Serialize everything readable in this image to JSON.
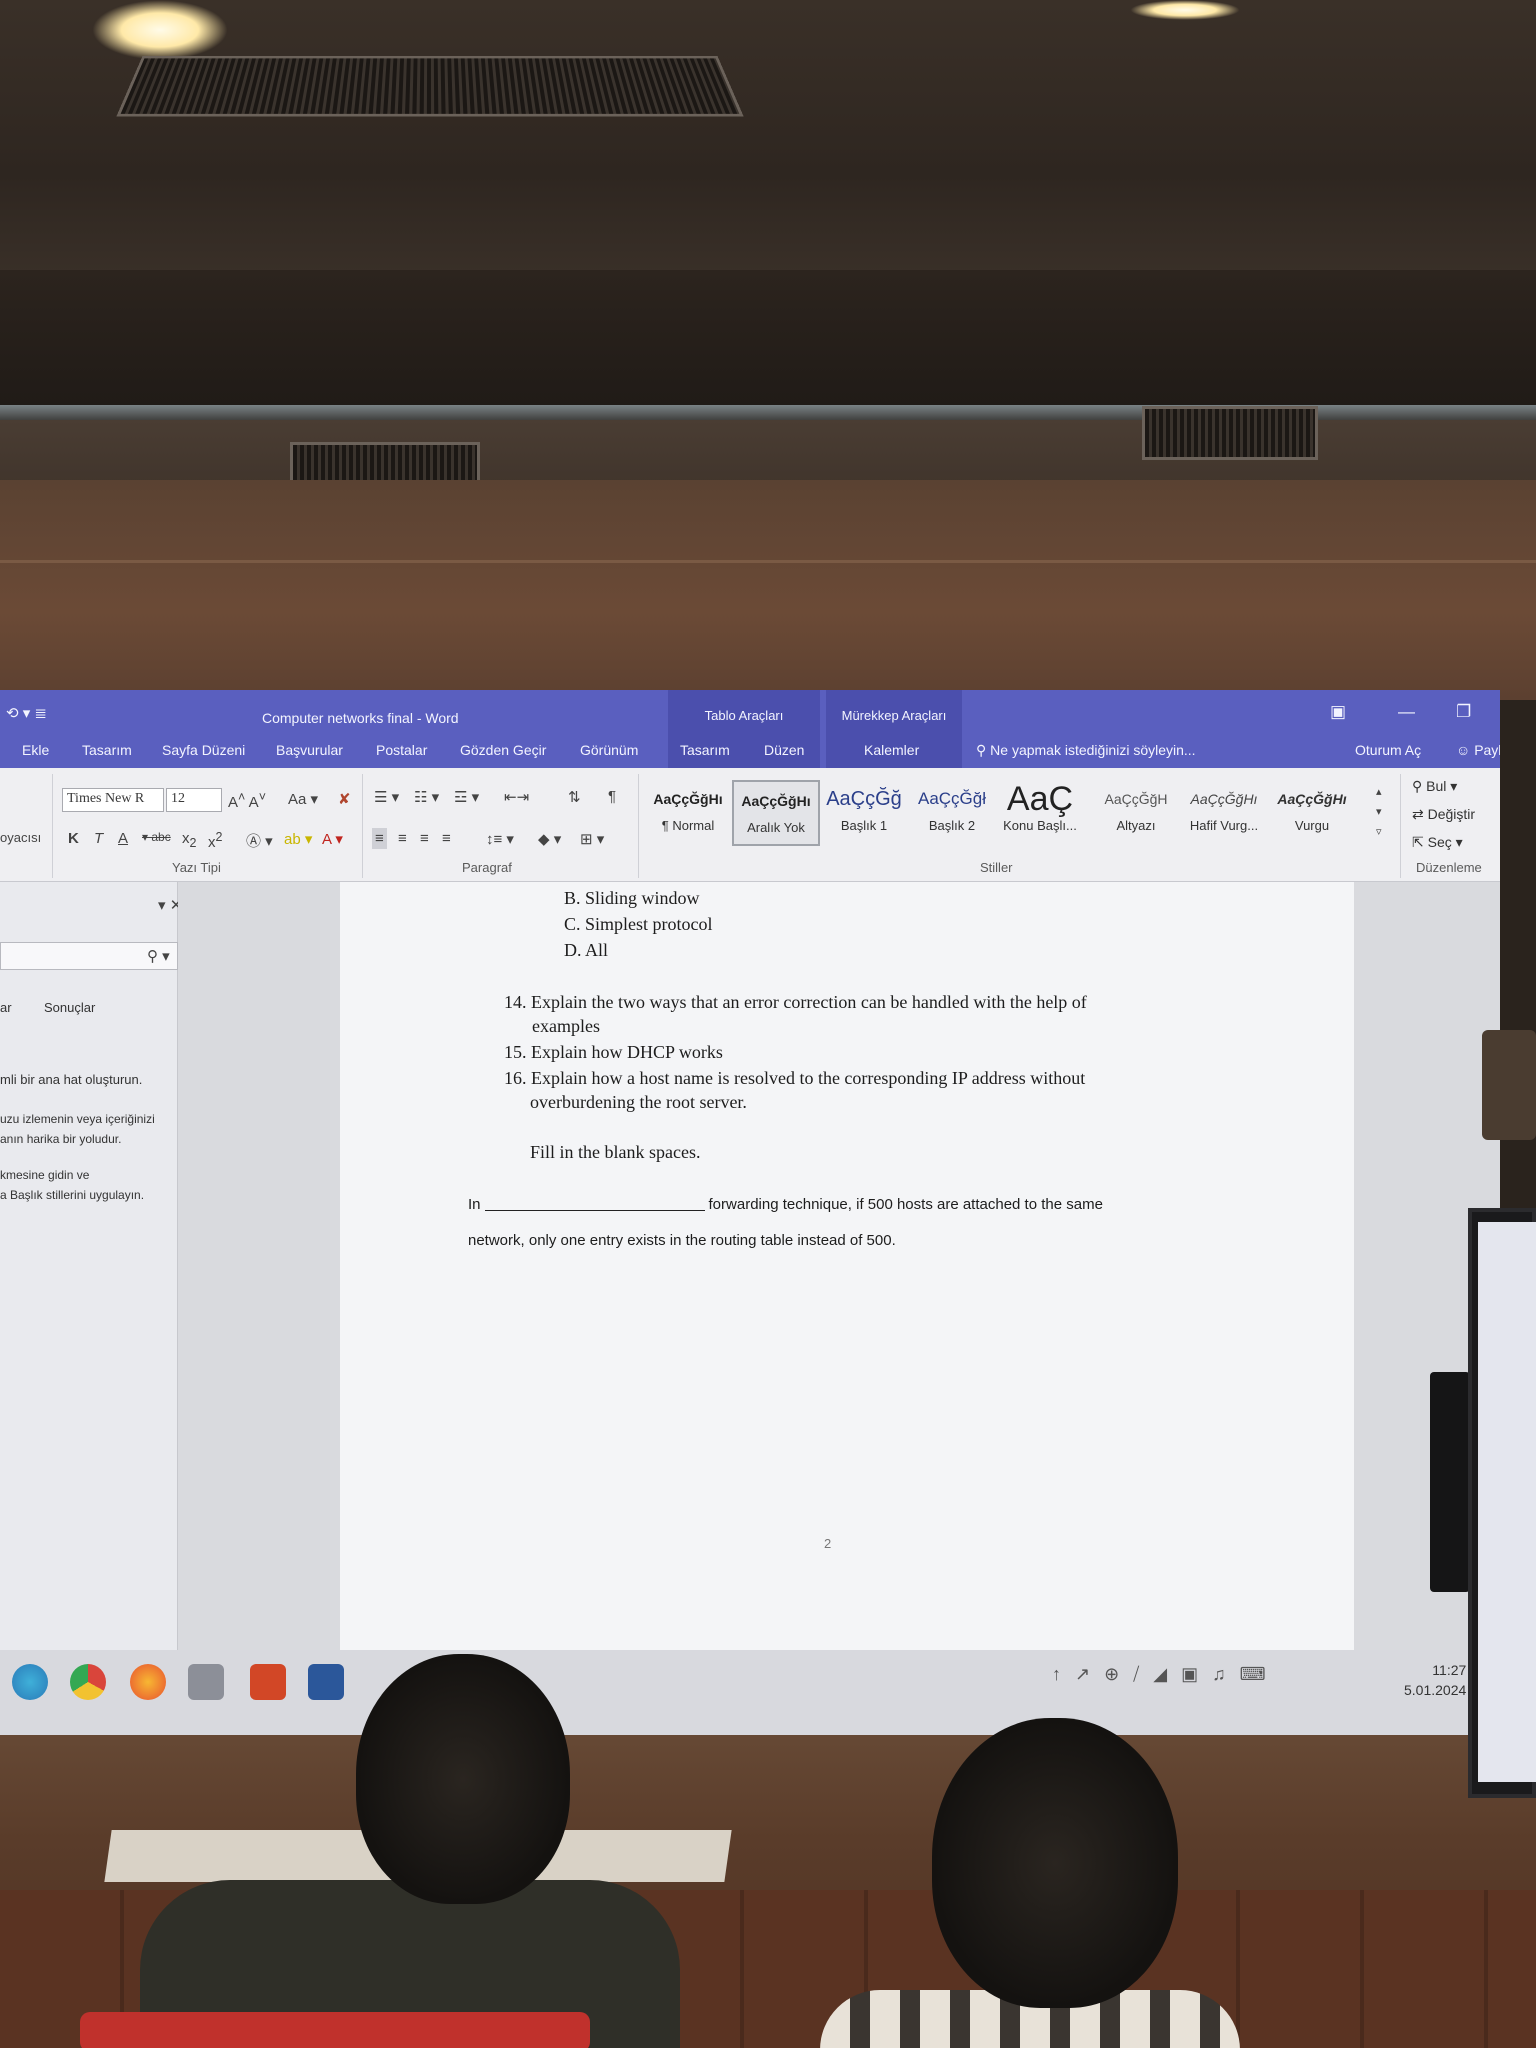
{
  "window": {
    "title": "Computer networks final - Word",
    "context_groups": [
      "Tablo Araçları",
      "Mürekkep Araçları"
    ],
    "tell_me": "Ne yapmak istediğinizi söyleyin...",
    "sign_in": "Oturum Aç",
    "share": "Paylaş"
  },
  "tabs": [
    "Ekle",
    "Tasarım",
    "Sayfa Düzeni",
    "Başvurular",
    "Postalar",
    "Gözden Geçir",
    "Görünüm",
    "Tasarım",
    "Düzen",
    "Kalemler"
  ],
  "ribbon": {
    "clipboard_label": "oyacısı",
    "font_name": "Times New R",
    "font_size": "12",
    "font_group_label": "Yazı Tipi",
    "paragraph_group_label": "Paragraf",
    "styles_group_label": "Stiller",
    "editing_group_label": "Düzenleme",
    "styles": [
      {
        "sample": "AaÇçĞğHı",
        "name": "¶ Normal"
      },
      {
        "sample": "AaÇçĞğHı",
        "name": "Aralık Yok"
      },
      {
        "sample": "AaÇçĞğ",
        "name": "Başlık 1"
      },
      {
        "sample": "AaÇçĞğł",
        "name": "Başlık 2"
      },
      {
        "sample": "AaÇ",
        "name": "Konu Başlı..."
      },
      {
        "sample": "AaÇçĞğH",
        "name": "Altyazı"
      },
      {
        "sample": "AaÇçĞğHı",
        "name": "Hafif Vurg..."
      },
      {
        "sample": "AaÇçĞğHı",
        "name": "Vurgu"
      }
    ],
    "editing": [
      "Bul",
      "Değiştir",
      "Seç"
    ]
  },
  "nav_pane": {
    "tabs": [
      "ar",
      "Sonuçlar"
    ],
    "lines": [
      "mli bir ana hat oluşturun.",
      "uzu izlemenin veya içeriğinizi",
      "anın harika bir yoludur.",
      "kmesine gidin ve",
      "a Başlık stillerini uygulayın."
    ]
  },
  "document": {
    "options": [
      "B.  Sliding window",
      "C.  Simplest protocol",
      "D.  All"
    ],
    "q14_a": "14. Explain the two ways that an error correction can be handled with the help of",
    "q14_b": "examples",
    "q15": "15. Explain how DHCP works",
    "q16_a": "16. Explain how a host name is resolved to the corresponding IP address without",
    "q16_b": "overburdening the root server.",
    "fill_heading": "Fill in the blank spaces.",
    "fill_prefix": "In",
    "fill_suffix": "forwarding technique, if 500 hosts are attached to the same",
    "fill_line2": "network, only one entry exists in the routing table instead of 500.",
    "page_number": "2"
  },
  "taskbar": {
    "time": "11:27",
    "date": "5.01.2024"
  },
  "colors": {
    "title_bar": "#5a5fbf",
    "ribbon": "#efeff2",
    "page": "#f4f5f7"
  }
}
